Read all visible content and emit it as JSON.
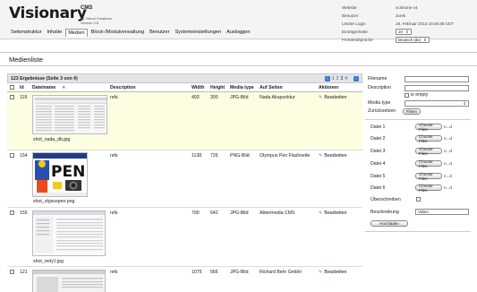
{
  "header": {
    "logo": "Visionary",
    "logo_sup": "CMS",
    "logo_by": "by Virtual Creations",
    "logo_version": "Version 0.8",
    "nav": [
      "Seitenstruktur",
      "Inhalte",
      "Medien",
      "Block-/Modulverwaltung",
      "Benutzer",
      "Systemeinstellungen",
      "Ausloggen"
    ],
    "meta": {
      "website_label": "Website",
      "website_value": "vcshome v4",
      "user_label": "Benutzer",
      "user_value": "Jurek",
      "lastlogin_label": "Letzter Login",
      "lastlogin_value": "19. Februar 2013 19:46:38 CET",
      "entries_label": "Einträge/Seite",
      "entries_value": "10",
      "frontend_label": "Frontendsprache",
      "frontend_value": "Deutsch (de)"
    }
  },
  "page_title": "Medienliste",
  "results": {
    "summary": "123 Ergebnisse (Seite 3 von 4)",
    "pages": [
      "1",
      "2",
      "3",
      "4"
    ],
    "current_page": "3"
  },
  "columns": [
    "Id",
    "Dateiname",
    "Description",
    "Width",
    "Height",
    "Media type",
    "Auf Seiten",
    "Aktionen"
  ],
  "rows": [
    {
      "id": "119",
      "filename": "shot_nada_db.jpg",
      "description": "refs",
      "width": "493",
      "height": "300",
      "type": "JPG-Bild",
      "pages": "Nada Akupunktur",
      "action": "Bearbeiten"
    },
    {
      "id": "154",
      "filename": "shot_olypuspen.png",
      "description": "refs",
      "width": "1138",
      "height": "726",
      "type": "PNG-Bild",
      "pages": "Olympus Pen Flashseite",
      "action": "Bearbeiten"
    },
    {
      "id": "155",
      "filename": "shot_redy1.jpg",
      "description": "refs",
      "width": "700",
      "height": "642",
      "type": "JPG-Bild",
      "pages": "Abtermedia CMS",
      "action": "Bearbeiten"
    },
    {
      "id": "121",
      "filename": "",
      "description": "refs",
      "width": "1075",
      "height": "566",
      "type": "JPG-Bild",
      "pages": "Richard Behr GmbH",
      "action": "Bearbeiten"
    }
  ],
  "panel": {
    "filename_label": "Filename",
    "description_label": "Description",
    "is_empty_label": "is empty",
    "media_type_label": "Media type",
    "reset_label": "Zurücksetzen",
    "filter_label": "Filtern",
    "files": [
      {
        "label": "Datei 1",
        "button": "Choose Files",
        "status": "n...d"
      },
      {
        "label": "Datei 2",
        "button": "Choose Files",
        "status": "n...d"
      },
      {
        "label": "Datei 3",
        "button": "Choose Files",
        "status": "n...d"
      },
      {
        "label": "Datei 4",
        "button": "Choose Files",
        "status": "n...d"
      },
      {
        "label": "Datei 5",
        "button": "Choose Files",
        "status": "n...d"
      },
      {
        "label": "Datei 6",
        "button": "Choose Files",
        "status": "n...d"
      }
    ],
    "overwrite_label": "Überschreiben",
    "beschreibung_label": "Beschreibung",
    "beschreibung_value": "Video",
    "upload_label": "Hochladen"
  },
  "colors": {
    "header_bg": "#f4f4f4",
    "highlight_row": "#fdfde2",
    "link_blue": "#1a5fb4",
    "pen_yellow": "#f4c91c"
  }
}
